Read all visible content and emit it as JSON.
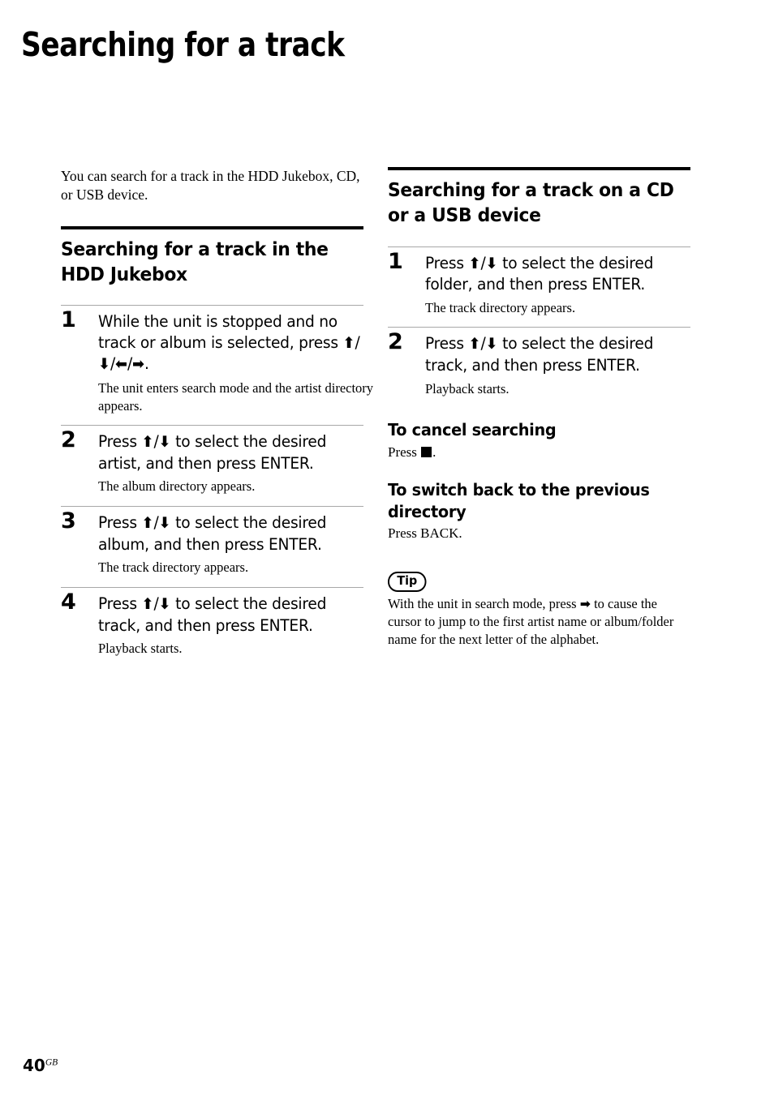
{
  "page": {
    "title": "Searching for a track",
    "footer_number": "40",
    "footer_suffix": "GB"
  },
  "intro": {
    "text": "You can search for a track in the HDD Jukebox, CD, or USB device."
  },
  "left_column": {
    "heading": "Searching for a track in the HDD Jukebox",
    "steps": [
      {
        "number": "1",
        "text_before": "While the unit is stopped and no track or album is selected, press ",
        "glyphs": [
          "up-arrow",
          "down-arrow",
          "left-arrow",
          "right-arrow"
        ],
        "text_after": ".",
        "note": "The unit enters search mode and the artist directory appears."
      },
      {
        "number": "2",
        "text_before": "Press ",
        "glyphs": [
          "up-arrow",
          "down-arrow"
        ],
        "text_after": " to select the desired artist, and then press ENTER.",
        "note": "The album directory appears."
      },
      {
        "number": "3",
        "text_before": "Press ",
        "glyphs": [
          "up-arrow",
          "down-arrow"
        ],
        "text_after": " to select the desired album, and then press ENTER.",
        "note": "The track directory appears."
      },
      {
        "number": "4",
        "text_before": "Press ",
        "glyphs": [
          "up-arrow",
          "down-arrow"
        ],
        "text_after": " to select the desired track, and then press ENTER.",
        "note": "Playback starts."
      }
    ]
  },
  "right_column": {
    "heading": "Searching for a track on a CD or a USB device",
    "steps": [
      {
        "number": "1",
        "text_before": "Press ",
        "glyphs": [
          "up-arrow",
          "down-arrow"
        ],
        "text_after": " to select the desired folder, and then press ENTER.",
        "note": "The track directory appears."
      },
      {
        "number": "2",
        "text_before": "Press ",
        "glyphs": [
          "up-arrow",
          "down-arrow"
        ],
        "text_after": " to select the desired track, and then press ENTER.",
        "note": "Playback starts."
      }
    ],
    "subsections": [
      {
        "heading": "To cancel searching",
        "body_before": "Press ",
        "glyph": "stop-square",
        "body_after": "."
      },
      {
        "heading": "To switch back to the previous directory",
        "body_before": "Press BACK.",
        "glyph": "",
        "body_after": ""
      }
    ],
    "tip": {
      "badge": "Tip",
      "text_before": "With the unit in search mode, press ",
      "glyph": "right-arrow",
      "text_after": " to cause the cursor to jump to the first artist name or album/folder name for the next letter of the alphabet."
    }
  },
  "colors": {
    "text": "#000000",
    "rule_heavy": "#000000",
    "rule_light": "#a8a8a8",
    "background": "#ffffff"
  }
}
